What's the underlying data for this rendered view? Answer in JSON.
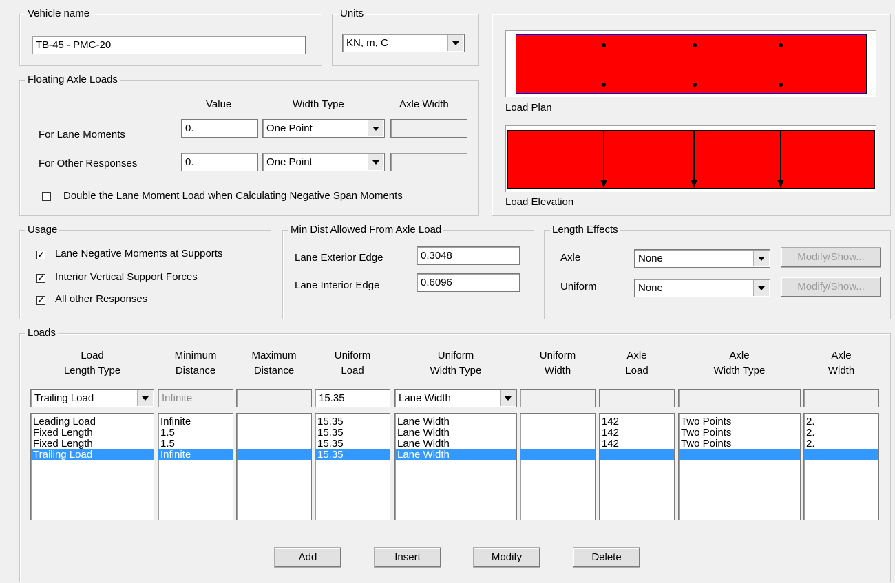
{
  "vehicle": {
    "title": "Vehicle name",
    "value": "TB-45 - PMC-20"
  },
  "units": {
    "title": "Units",
    "value": "KN, m, C"
  },
  "floating": {
    "title": "Floating Axle Loads",
    "col_value": "Value",
    "col_width_type": "Width Type",
    "col_axle_width": "Axle Width",
    "lane_moments_label": "For Lane Moments",
    "lane_moments_value": "0.",
    "lane_moments_type": "One Point",
    "other_responses_label": "For Other Responses",
    "other_responses_value": "0.",
    "other_responses_type": "One Point",
    "double_label": "Double the Lane Moment Load when Calculating Negative Span Moments",
    "double_checked": false
  },
  "preview": {
    "plan_label": "Load Plan",
    "elevation_label": "Load Elevation",
    "load_color": "#ff0000",
    "edge_color": "#0000ff"
  },
  "usage": {
    "title": "Usage",
    "items": [
      {
        "label": "Lane Negative Moments at Supports",
        "checked": true
      },
      {
        "label": "Interior Vertical Support Forces",
        "checked": true
      },
      {
        "label": "All other Responses",
        "checked": true
      }
    ]
  },
  "min_dist": {
    "title": "Min Dist Allowed From Axle Load",
    "exterior_label": "Lane Exterior Edge",
    "exterior_value": "0.3048",
    "interior_label": "Lane Interior Edge",
    "interior_value": "0.6096"
  },
  "length_effects": {
    "title": "Length Effects",
    "axle_label": "Axle",
    "axle_value": "None",
    "uniform_label": "Uniform",
    "uniform_value": "None",
    "modify_label": "Modify/Show..."
  },
  "loads": {
    "title": "Loads",
    "headers": [
      [
        "Load",
        "Length Type"
      ],
      [
        "Minimum",
        "Distance"
      ],
      [
        "Maximum",
        "Distance"
      ],
      [
        "Uniform",
        "Load"
      ],
      [
        "Uniform",
        "Width Type"
      ],
      [
        "Uniform",
        "Width"
      ],
      [
        "Axle",
        "Load"
      ],
      [
        "Axle",
        "Width Type"
      ],
      [
        "Axle",
        "Width"
      ]
    ],
    "edit": [
      "Trailing Load",
      "Infinite",
      "",
      "15.35",
      "Lane Width",
      "",
      "",
      "",
      ""
    ],
    "rows": [
      [
        "Leading Load",
        "Infinite",
        "",
        "15.35",
        "Lane Width",
        "",
        "142",
        "Two Points",
        "2."
      ],
      [
        "Fixed Length",
        "1.5",
        "",
        "15.35",
        "Lane Width",
        "",
        "142",
        "Two Points",
        "2."
      ],
      [
        "Fixed Length",
        "1.5",
        "",
        "15.35",
        "Lane Width",
        "",
        "142",
        "Two Points",
        "2."
      ],
      [
        "Trailing Load",
        "Infinite",
        "",
        "15.35",
        "Lane Width",
        "",
        "",
        "",
        ""
      ]
    ],
    "selected_row": 3,
    "buttons": {
      "add": "Add",
      "insert": "Insert",
      "modify": "Modify",
      "delete": "Delete"
    }
  }
}
